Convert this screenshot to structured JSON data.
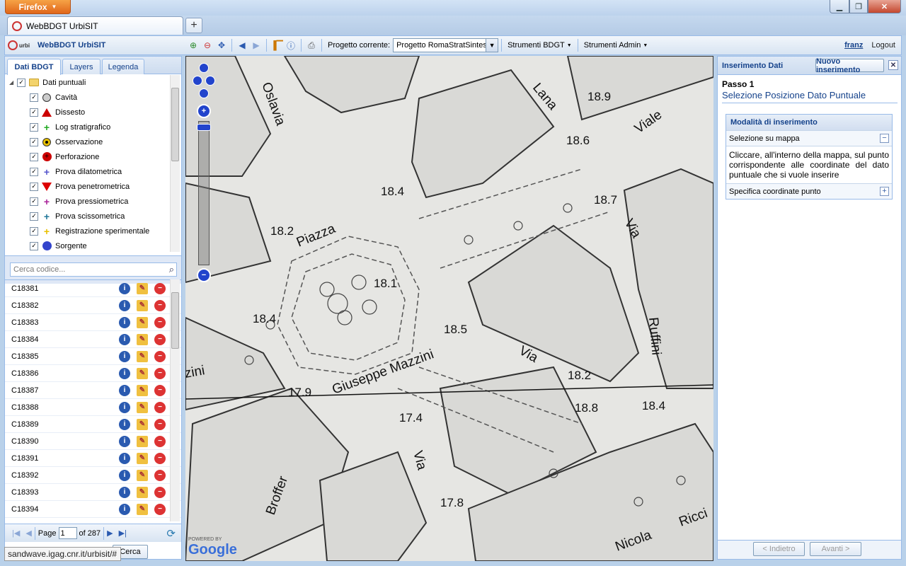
{
  "browser": {
    "menu_label": "Firefox",
    "tab_title": "WebBDGT UrbiSIT",
    "status_url": "sandwave.igag.cnr.it/urbisit/#"
  },
  "app": {
    "logo_text": "urbi",
    "title": "WebBDGT UrbiSIT",
    "progetto_label": "Progetto corrente:",
    "progetto_value": "Progetto RomaStratSintes",
    "menu_bdgt": "Strumenti BDGT",
    "menu_admin": "Strumenti Admin",
    "user": "franz",
    "logout": "Logout"
  },
  "left_tabs": [
    "Dati BDGT",
    "Layers",
    "Legenda"
  ],
  "tree": {
    "root": "Dati puntuali",
    "items": [
      {
        "label": "Cavità",
        "icon": "circle-outline-icon",
        "color": "#cccccc"
      },
      {
        "label": "Dissesto",
        "icon": "triangle-icon",
        "color": "#cc0000"
      },
      {
        "label": "Log stratigrafico",
        "icon": "plus-icon",
        "color": "#22aa22"
      },
      {
        "label": "Osservazione",
        "icon": "target-icon",
        "color": "#e8c000"
      },
      {
        "label": "Perforazione",
        "icon": "circle-cross-icon",
        "color": "#cc0000"
      },
      {
        "label": "Prova dilatometrica",
        "icon": "plus-icon",
        "color": "#5555cc"
      },
      {
        "label": "Prova penetrometrica",
        "icon": "triangle-down-icon",
        "color": "#dd0000"
      },
      {
        "label": "Prova pressiometrica",
        "icon": "plus-icon",
        "color": "#aa2299"
      },
      {
        "label": "Prova scissometrica",
        "icon": "plus-icon",
        "color": "#227799"
      },
      {
        "label": "Registrazione sperimentale",
        "icon": "plus-icon",
        "color": "#e8c000"
      },
      {
        "label": "Sorgente",
        "icon": "circle-icon",
        "color": "#3344cc"
      }
    ]
  },
  "search_placeholder": "Cerca codice...",
  "codes": [
    "C18381",
    "C18382",
    "C18383",
    "C18384",
    "C18385",
    "C18386",
    "C18387",
    "C18388",
    "C18389",
    "C18390",
    "C18391",
    "C18392",
    "C18393",
    "C18394"
  ],
  "pager": {
    "page_label": "Page",
    "page_value": "1",
    "of_label": "of 287"
  },
  "bottom_button": "Cerca",
  "map": {
    "labels": [
      {
        "text": "18.9"
      },
      {
        "text": "18.6"
      },
      {
        "text": "18.7"
      },
      {
        "text": "18.4"
      },
      {
        "text": "18.2"
      },
      {
        "text": "18.1"
      },
      {
        "text": "18.4"
      },
      {
        "text": "18.5"
      },
      {
        "text": "18.2"
      },
      {
        "text": "17.9"
      },
      {
        "text": "18.8"
      },
      {
        "text": "18.4"
      },
      {
        "text": "17.4"
      },
      {
        "text": "17.8"
      }
    ],
    "streets": [
      "Oslavia",
      "Lana",
      "Viale",
      "Piazza",
      "Via",
      "Ruffini",
      "Via",
      "Giuseppe Mazzini",
      "zini",
      "Via",
      "Broffer",
      "Nicola",
      "Ricci"
    ],
    "powered_by": "POWERED BY",
    "google": "Google"
  },
  "right_panel": {
    "title": "Inserimento Dati",
    "new_button": "Nuovo inserimento",
    "step": "Passo 1",
    "step_title": "Selezione Posizione Dato Puntuale",
    "fieldset_title": "Modalità di inserimento",
    "option1": "Selezione su mappa",
    "option1_text": "Cliccare, all'interno della mappa, sul punto corrispondente alle coordinate del dato puntuale che si vuole inserire",
    "option2": "Specifica coordinate punto",
    "back_button": "< Indietro",
    "next_button": "Avanti >"
  }
}
